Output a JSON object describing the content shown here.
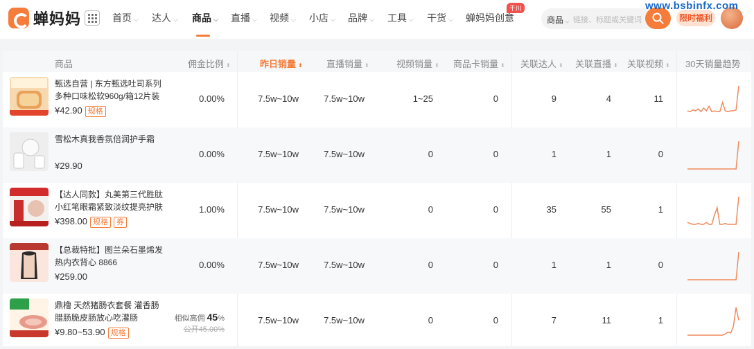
{
  "logo": {
    "text": "蝉妈妈"
  },
  "nav": [
    {
      "label": "首页",
      "chev": true,
      "active": false
    },
    {
      "label": "达人",
      "chev": true,
      "active": false
    },
    {
      "label": "商品",
      "chev": true,
      "active": true
    },
    {
      "label": "直播",
      "chev": true,
      "active": false
    },
    {
      "label": "视频",
      "chev": true,
      "active": false
    },
    {
      "label": "小店",
      "chev": true,
      "active": false
    },
    {
      "label": "品牌",
      "chev": true,
      "active": false
    },
    {
      "label": "工具",
      "chev": true,
      "active": false
    },
    {
      "label": "干货",
      "chev": true,
      "active": false
    },
    {
      "label": "蝉妈妈创意",
      "chev": false,
      "active": false
    }
  ],
  "nav_badge": "千川",
  "search": {
    "type": "商品",
    "placeholder": "链接、标题或关键词"
  },
  "promo": "限时福利",
  "watermark": "www.bsbinfx.com",
  "columns": {
    "product": "商品",
    "commission": "佣金比例",
    "yesterday": "昨日销量",
    "live": "直播销量",
    "video": "视频销量",
    "card": "商品卡销量",
    "influencers": "关联达人",
    "lives": "关联直播",
    "videos": "关联视频",
    "trend": "30天销量趋势"
  },
  "rows": [
    {
      "name": "甄选自营 | 东方甄选吐司系列多种口味松软960g/箱12片装配…",
      "price": "¥42.90",
      "tags": [
        "规格"
      ],
      "commission": "0.00%",
      "yesterday": "7.5w~10w",
      "live": "7.5w~10w",
      "video": "1~25",
      "card": "0",
      "influencers": "9",
      "lives": "4",
      "videos": "11",
      "trend": [
        3,
        2,
        4,
        3,
        5,
        2,
        6,
        3,
        8,
        2,
        3,
        2,
        2,
        12,
        3,
        2,
        3,
        3,
        4,
        30
      ]
    },
    {
      "name": "雪松木真我香氛倍润护手霜",
      "price": "¥29.90",
      "tags": [],
      "commission": "0.00%",
      "yesterday": "7.5w~10w",
      "live": "7.5w~10w",
      "video": "0",
      "card": "0",
      "influencers": "1",
      "lives": "1",
      "videos": "0",
      "trend": [
        0,
        0,
        0,
        0,
        0,
        0,
        0,
        0,
        0,
        0,
        0,
        0,
        0,
        0,
        0,
        0,
        0,
        0,
        0,
        30
      ]
    },
    {
      "name": "【达人同款】丸美第三代胜肽小红笔眼霜紧致淡纹提亮护肤按…",
      "price": "¥398.00",
      "tags": [
        "规格",
        "券"
      ],
      "commission": "1.00%",
      "yesterday": "7.5w~10w",
      "live": "7.5w~10w",
      "video": "0",
      "card": "0",
      "influencers": "35",
      "lives": "55",
      "videos": "1",
      "trend": [
        2,
        1,
        0,
        0,
        1,
        0,
        0,
        2,
        0,
        0,
        10,
        18,
        0,
        0,
        1,
        0,
        0,
        0,
        0,
        30
      ]
    },
    {
      "name": "【总裁特批】图兰朵石墨烯发热内衣背心 8866",
      "price": "¥259.00",
      "tags": [],
      "commission": "0.00%",
      "yesterday": "7.5w~10w",
      "live": "7.5w~10w",
      "video": "0",
      "card": "0",
      "influencers": "1",
      "lives": "1",
      "videos": "0",
      "trend": [
        0,
        0,
        0,
        0,
        0,
        0,
        0,
        0,
        0,
        0,
        0,
        0,
        0,
        0,
        0,
        0,
        0,
        0,
        0,
        30
      ]
    },
    {
      "name": "鼎橹 天然猪肠衣套餐 灌香肠腊肠脆皮肠放心吃灌肠",
      "price": "¥9.80~53.90",
      "tags": [
        "规格"
      ],
      "commission_label": "相似高佣",
      "commission_high": "45",
      "commission_unit": "%",
      "commission_old": "公开45.00%",
      "yesterday": "7.5w~10w",
      "live": "7.5w~10w",
      "video": "0",
      "card": "0",
      "influencers": "7",
      "lives": "11",
      "videos": "1",
      "trend": [
        0,
        0,
        0,
        0,
        0,
        0,
        0,
        0,
        0,
        0,
        0,
        0,
        0,
        0,
        1,
        3,
        2,
        8,
        26,
        14
      ]
    }
  ],
  "colors": {
    "accent": "#f57c3a",
    "trend_line": "#f08a5d"
  }
}
